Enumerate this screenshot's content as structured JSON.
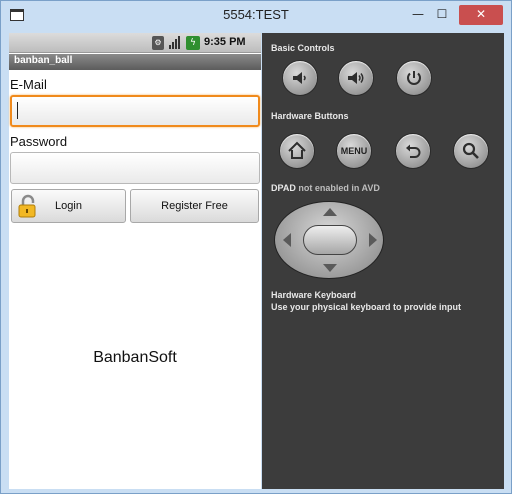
{
  "window": {
    "title": "5554:TEST",
    "minimize_glyph": "—",
    "maximize_glyph": "☐",
    "close_glyph": "✕"
  },
  "statusbar": {
    "time": "9:35 PM",
    "icons": [
      "usb-debug-icon",
      "signal-icon",
      "battery-icon"
    ]
  },
  "app": {
    "title": "banban_ball",
    "email_label": "E-Mail",
    "email_value": "",
    "password_label": "Password",
    "password_value": "",
    "login_button": "Login",
    "register_button": "Register Free",
    "brand": "BanbanSoft"
  },
  "controls": {
    "basic_title": "Basic Controls",
    "basic_buttons": [
      "volume-down-icon",
      "volume-up-icon",
      "power-icon"
    ],
    "hardware_title": "Hardware Buttons",
    "hardware_buttons": [
      "home-icon",
      "menu-button",
      "back-icon",
      "search-icon"
    ],
    "menu_label": "MENU",
    "dpad_title": "DPAD",
    "dpad_note": "not enabled in AVD",
    "keyboard_title": "Hardware Keyboard",
    "keyboard_note": "Use your physical keyboard to provide input"
  },
  "colors": {
    "focus_border": "#f08a1c",
    "controls_bg": "#3c3c3c",
    "close_button": "#c94f4f",
    "titlebar_bg": "#c9def3"
  }
}
